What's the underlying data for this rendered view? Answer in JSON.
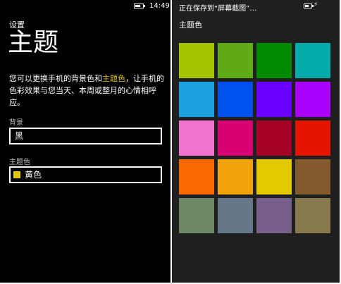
{
  "left": {
    "clock": "14:49",
    "app_title": "设置",
    "page_title": "主题",
    "description_prefix": "您可以更换手机的背景色和",
    "description_accent": "主题色",
    "description_suffix": "，让手机的色彩效果与您当天、本周或整月的心情相呼应。",
    "background_label": "背景",
    "background_value": "黑",
    "accent_label": "主题色",
    "accent_value": "黄色"
  },
  "right": {
    "status_message": "正在保存到“屏幕截图”…",
    "grid_title": "主题色"
  },
  "colors": {
    "accent": "#e3c800",
    "swatches": [
      "#a4c400",
      "#60a917",
      "#008a00",
      "#00aba9",
      "#1ba1e2",
      "#0050ef",
      "#6a00ff",
      "#aa00ff",
      "#f472d0",
      "#d80073",
      "#a20025",
      "#e51400",
      "#fa6800",
      "#f0a30a",
      "#e3c800",
      "#825a2c",
      "#6d8764",
      "#647687",
      "#76608a",
      "#87794e"
    ]
  }
}
